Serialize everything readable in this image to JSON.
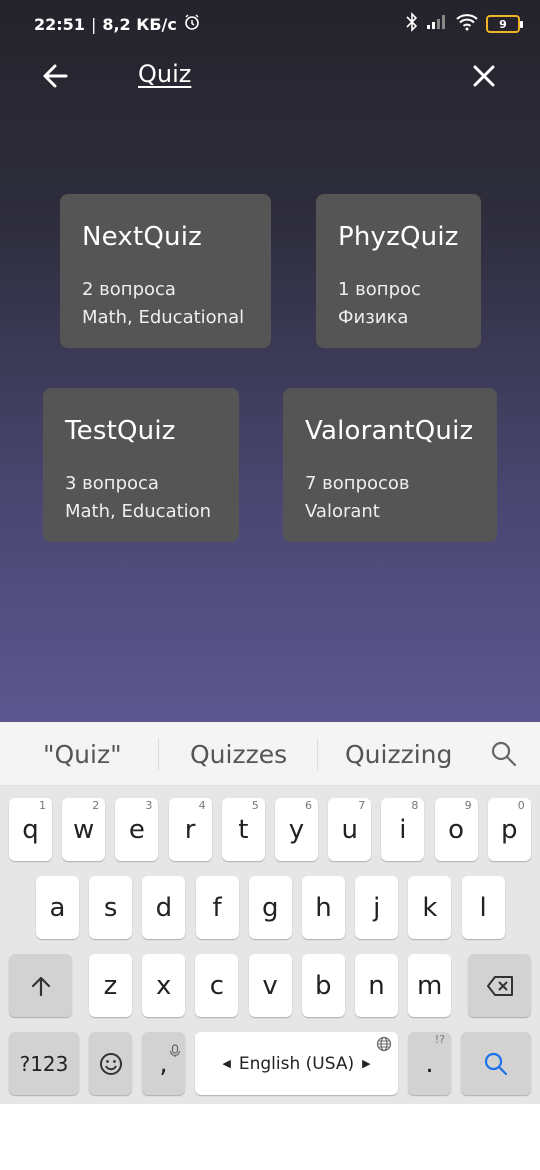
{
  "status_bar": {
    "time": "22:51",
    "speed": "8,2 КБ/с",
    "battery": "9"
  },
  "search": {
    "query": "Quiz"
  },
  "quizzes": [
    {
      "title": "NextQuiz",
      "count": "2 вопроса",
      "tags": "Math, Educational"
    },
    {
      "title": "PhyzQuiz",
      "count": "1 вопрос",
      "tags": "Физика"
    },
    {
      "title": "TestQuiz",
      "count": "3 вопроса",
      "tags": "Math, Education"
    },
    {
      "title": "ValorantQuiz",
      "count": "7 вопросов",
      "tags": "Valorant"
    }
  ],
  "keyboard": {
    "suggestions": [
      "\"Quiz\"",
      "Quizzes",
      "Quizzing"
    ],
    "row1": [
      "q",
      "w",
      "e",
      "r",
      "t",
      "y",
      "u",
      "i",
      "o",
      "p"
    ],
    "row1_hints": [
      "1",
      "2",
      "3",
      "4",
      "5",
      "6",
      "7",
      "8",
      "9",
      "0"
    ],
    "row2": [
      "a",
      "s",
      "d",
      "f",
      "g",
      "h",
      "j",
      "k",
      "l"
    ],
    "row3": [
      "z",
      "x",
      "c",
      "v",
      "b",
      "n",
      "m"
    ],
    "symbols_label": "?123",
    "comma": ",",
    "space_label": "English (USA)",
    "period": ".",
    "period_hint": "!?"
  },
  "colors": {
    "card_bg": "#555555",
    "accent_search": "#1a73e8"
  }
}
